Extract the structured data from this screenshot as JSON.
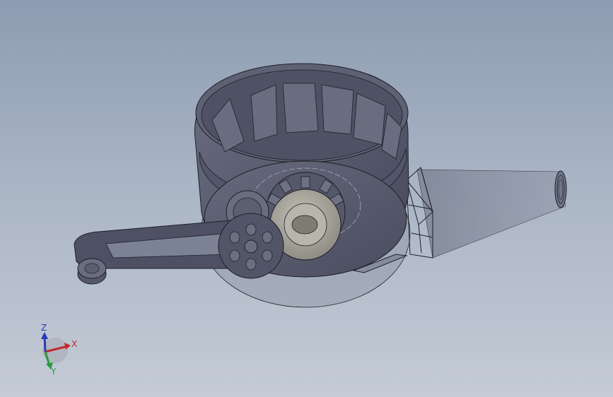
{
  "viewport": {
    "background_top": "#8d9cb2",
    "background_bottom": "#c4cbd6"
  },
  "model": {
    "icons": {
      "housing": "blower-housing-icon",
      "crank": "hand-crank-icon",
      "gears": "gear-icon"
    },
    "colors": {
      "housing": "#5a5d6e",
      "housing_dark": "#3e4150",
      "gear": "#a7a49b",
      "wireframe": "#1d1f26"
    }
  },
  "triad": {
    "x_label": "X",
    "y_label": "Y",
    "z_label": "Z",
    "colors": {
      "x": "#c0282d",
      "y": "#2a9a3a",
      "z": "#2a3bb0"
    }
  }
}
